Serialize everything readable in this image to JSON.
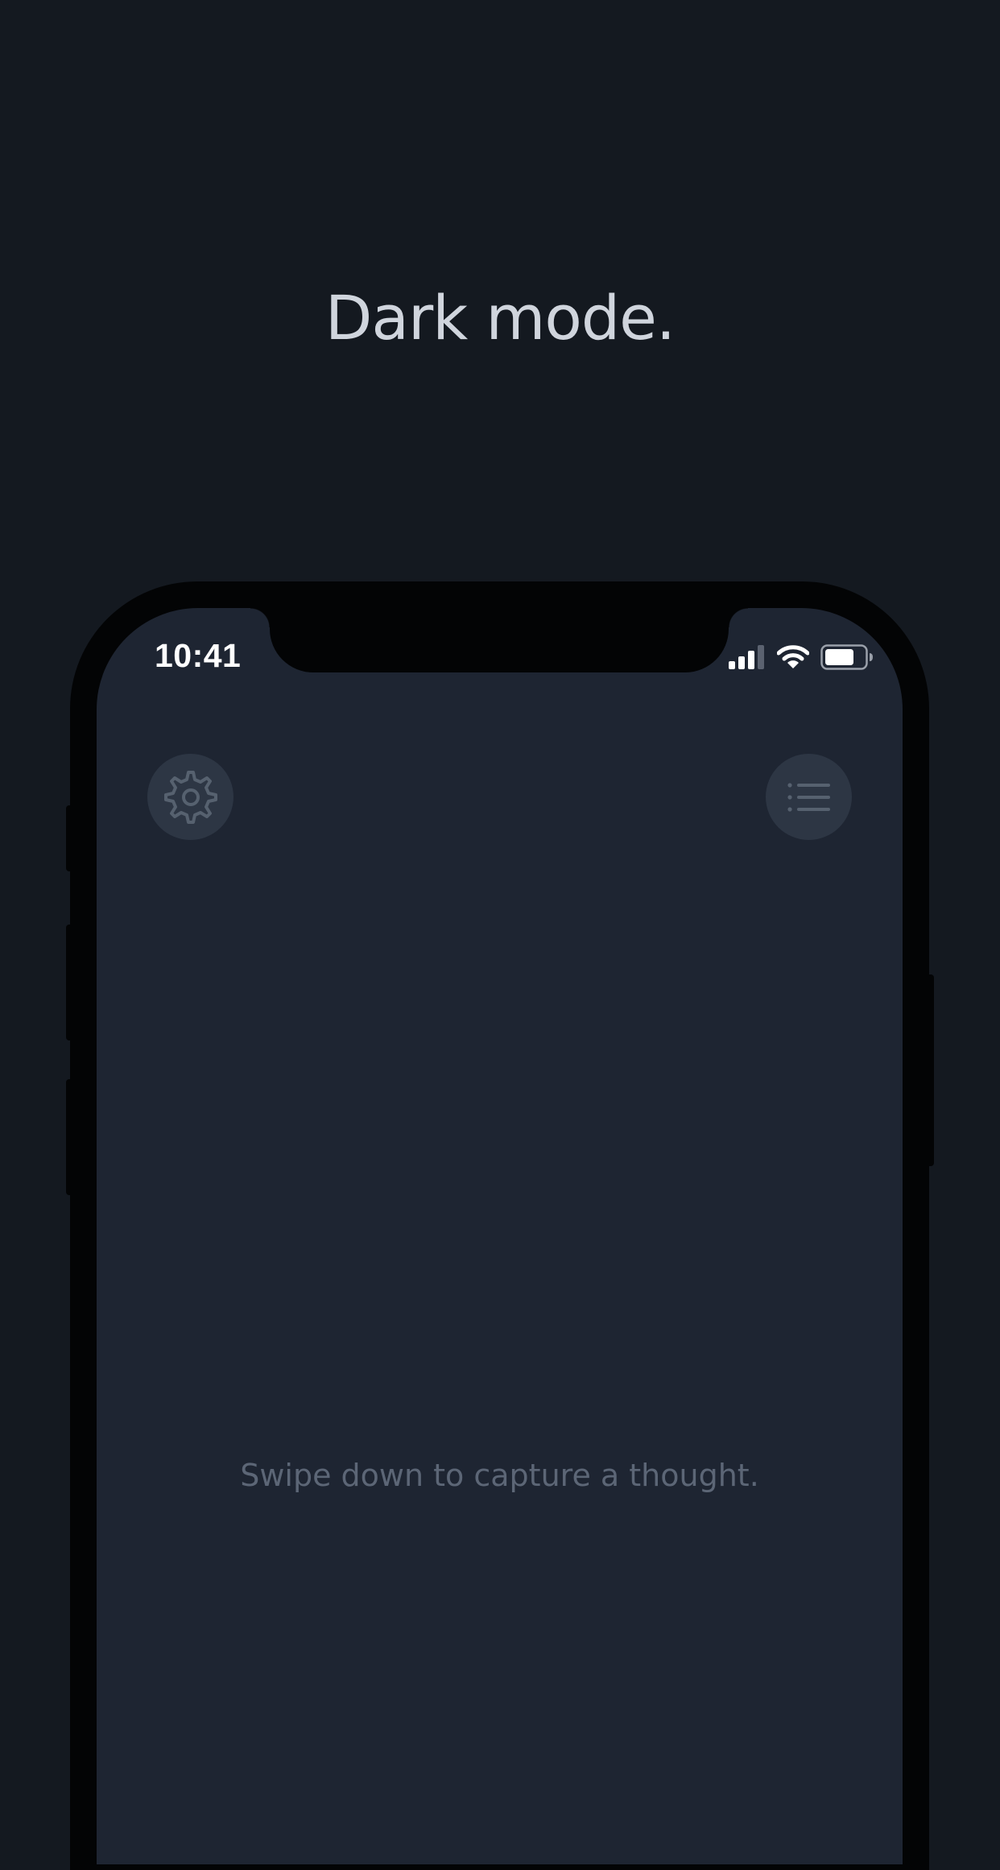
{
  "promo": {
    "headline": "Dark mode."
  },
  "status_bar": {
    "time": "10:41",
    "icons": [
      "cellular-signal-icon",
      "wifi-icon",
      "battery-icon"
    ]
  },
  "toolbar": {
    "left_icon": "gear-icon",
    "right_icon": "list-icon"
  },
  "main": {
    "empty_hint": "Swipe down to capture a thought."
  },
  "colors": {
    "page_background": "#141920",
    "screen_background": "#1e2532",
    "button_background": "#2d3644",
    "icon_color": "#56616f",
    "hint_text": "#5c6676",
    "headline_text": "#d0d5dd"
  }
}
